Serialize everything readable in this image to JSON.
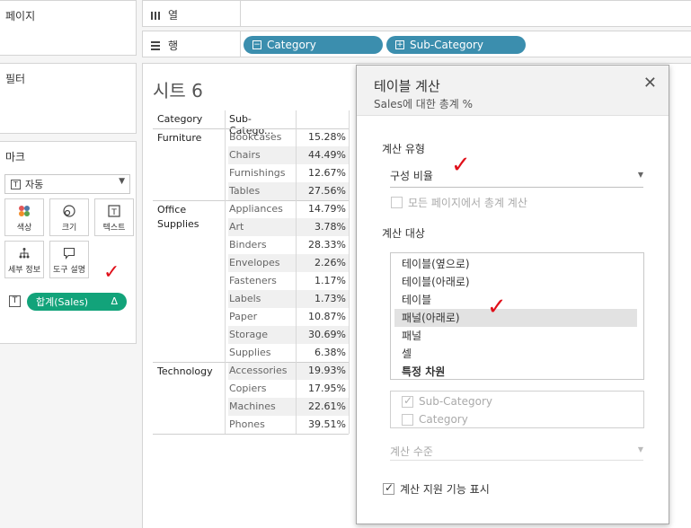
{
  "left_panel": {
    "pages_title": "페이지",
    "filters_title": "필터",
    "marks_title": "마크",
    "mark_type": "자동",
    "mark_buttons": {
      "color": "색상",
      "size": "크기",
      "text": "텍스트",
      "detail": "세부 정보",
      "tooltip": "도구 설명"
    },
    "sales_pill": "합계(Sales)",
    "sales_pill_delta": "Δ"
  },
  "shelves": {
    "columns_label": "열",
    "rows_label": "행",
    "row_pills": [
      "Category",
      "Sub-Category"
    ]
  },
  "sheet": {
    "title": "시트 6",
    "headers": [
      "Category",
      "Sub-Catego..."
    ],
    "groups": [
      {
        "category": "Furniture",
        "rows": [
          {
            "sub": "Bookcases",
            "value": "15.28%"
          },
          {
            "sub": "Chairs",
            "value": "44.49%"
          },
          {
            "sub": "Furnishings",
            "value": "12.67%"
          },
          {
            "sub": "Tables",
            "value": "27.56%"
          }
        ]
      },
      {
        "category": "Office Supplies",
        "rows": [
          {
            "sub": "Appliances",
            "value": "14.79%"
          },
          {
            "sub": "Art",
            "value": "3.78%"
          },
          {
            "sub": "Binders",
            "value": "28.33%"
          },
          {
            "sub": "Envelopes",
            "value": "2.26%"
          },
          {
            "sub": "Fasteners",
            "value": "1.17%"
          },
          {
            "sub": "Labels",
            "value": "1.73%"
          },
          {
            "sub": "Paper",
            "value": "10.87%"
          },
          {
            "sub": "Storage",
            "value": "30.69%"
          },
          {
            "sub": "Supplies",
            "value": "6.38%"
          }
        ]
      },
      {
        "category": "Technology",
        "rows": [
          {
            "sub": "Accessories",
            "value": "19.93%"
          },
          {
            "sub": "Copiers",
            "value": "17.95%"
          },
          {
            "sub": "Machines",
            "value": "22.61%"
          },
          {
            "sub": "Phones",
            "value": "39.51%"
          }
        ]
      }
    ]
  },
  "dialog": {
    "title": "테이블 계산",
    "subtitle": "Sales에 대한 총계 %",
    "calc_type_label": "계산 유형",
    "calc_type_value": "구성 비율",
    "all_pages_label": "모든 페이지에서 총계 계산",
    "compute_using_label": "계산 대상",
    "compute_options": [
      "테이블(옆으로)",
      "테이블(아래로)",
      "테이블",
      "패널(아래로)",
      "패널",
      "셀",
      "특정 차원"
    ],
    "selected_option": "패널(아래로)",
    "dimensions": [
      "Sub-Category",
      "Category"
    ],
    "level_label": "계산 수준",
    "show_assist_label": "계산 지원 기능 표시"
  },
  "colors": {
    "pill_green": "#12a37a",
    "pill_blue": "#3b8eae",
    "annotation_red": "#e0101a"
  }
}
